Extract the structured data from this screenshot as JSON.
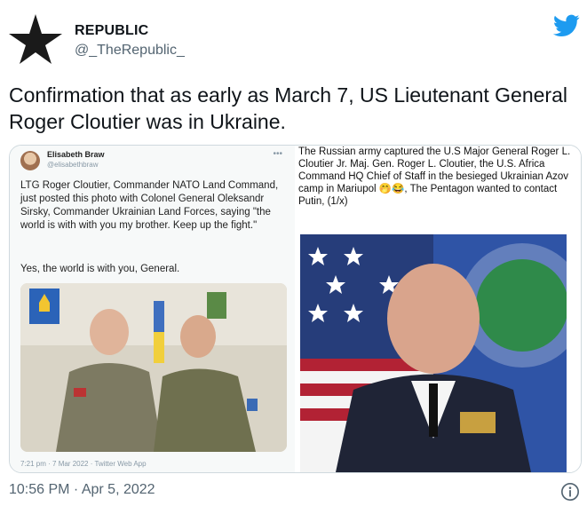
{
  "author": {
    "name": "REPUBLIC",
    "handle": "@_TheRepublic_"
  },
  "tweet": {
    "text": "Confirmation that as early as March 7, US Lieutenant General Roger Cloutier was in Ukraine."
  },
  "media": {
    "left": {
      "embedded_name": "Elisabeth Braw",
      "embedded_handle": "@elisabethbraw",
      "embedded_text": "LTG Roger Cloutier, Commander NATO Land Command, just posted this photo with Colonel General Oleksandr Sirsky, Commander Ukrainian Land Forces, saying \"the world is with with you my brother. Keep up the fight.\"",
      "embedded_reply": "Yes, the world is with you, General.",
      "embedded_meta": "7:21 pm · 7 Mar 2022 · Twitter Web App"
    },
    "right": {
      "caption": "The Russian army captured the U.S Major General Roger L. Cloutier Jr. Maj. Gen. Roger L. Cloutier, the U.S. Africa Command HQ Chief of Staff in the besieged Ukrainian Azov camp in Mariupol 🤭😂, The Pentagon wanted to contact Putin, (1/x)"
    }
  },
  "footer": {
    "timestamp": "10:56 PM · Apr 5, 2022"
  },
  "icons": {
    "avatar": "black-star-icon",
    "platform": "twitter-bird-icon",
    "info": "info-icon"
  },
  "colors": {
    "twitter_blue": "#1d9bf0",
    "secondary_text": "#536471"
  }
}
